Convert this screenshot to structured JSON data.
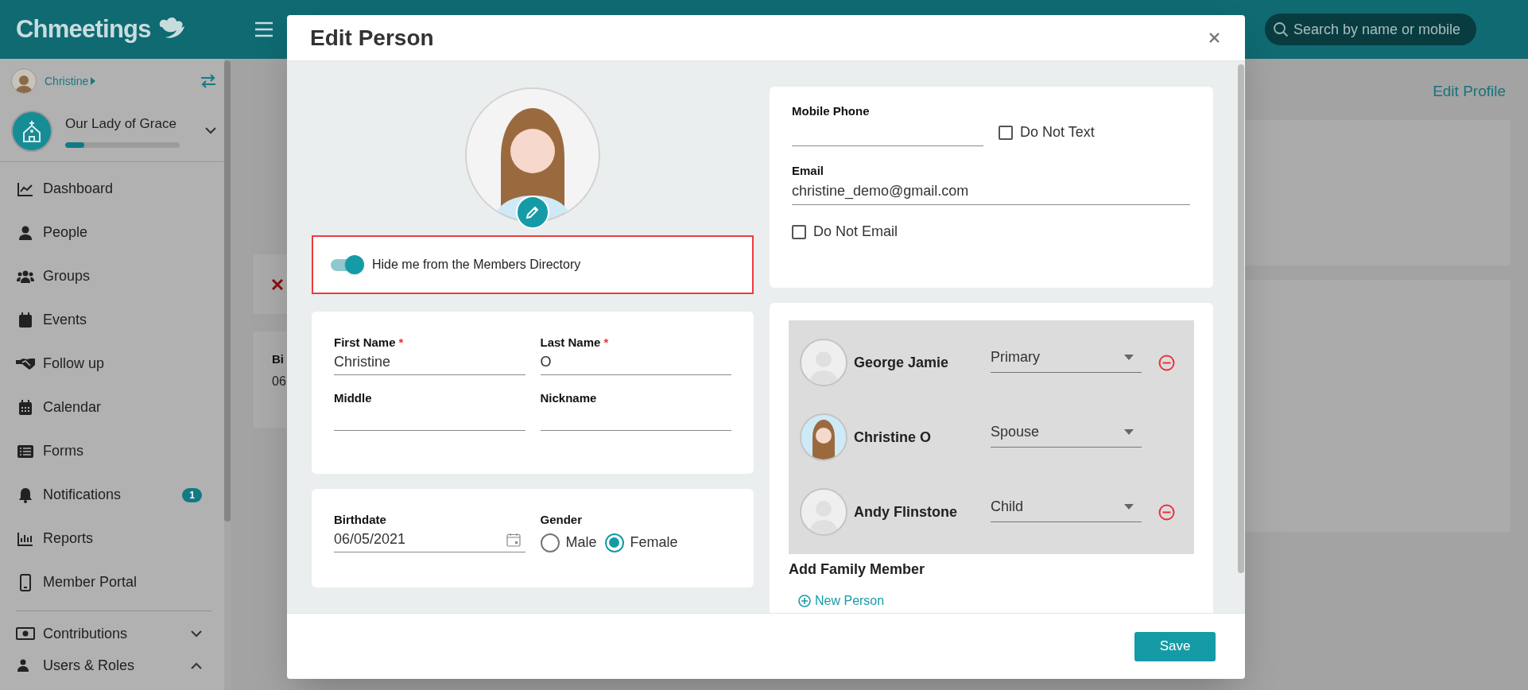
{
  "header": {
    "logo": "Chmeetings",
    "search": {
      "placeholder": "Search by name or mobile"
    }
  },
  "sidebar": {
    "user": "Christine",
    "church": {
      "name": "Our Lady of Grace",
      "level": 0.17
    },
    "items": [
      {
        "label": "Dashboard",
        "kind": "link"
      },
      {
        "label": "People",
        "kind": "link"
      },
      {
        "label": "Groups",
        "kind": "link"
      },
      {
        "label": "Events",
        "kind": "link"
      },
      {
        "label": "Follow up",
        "kind": "link"
      },
      {
        "label": "Calendar",
        "kind": "link"
      },
      {
        "label": "Forms",
        "kind": "link"
      },
      {
        "label": "Notifications",
        "kind": "link",
        "badge": "1"
      },
      {
        "label": "Reports",
        "kind": "link"
      },
      {
        "label": "Member Portal",
        "kind": "link"
      },
      {
        "label": "Contributions",
        "kind": "group",
        "expanded": false
      },
      {
        "label": "Users & Roles",
        "kind": "group",
        "expanded": true
      }
    ]
  },
  "page": {
    "edit_profile": "Edit Profile",
    "card": {
      "label": "Bi",
      "value": "06"
    }
  },
  "modal": {
    "title": "Edit Person",
    "hide_from_directory": {
      "label": "Hide me from the Members Directory",
      "on": true,
      "highlighted": true
    },
    "name_fields": [
      {
        "label": "First Name",
        "required_mark": "*",
        "value": "Christine"
      },
      {
        "label": "Last Name",
        "required_mark": "*",
        "value": "O"
      },
      {
        "label": "Middle"
      },
      {
        "label": "Nickname"
      }
    ],
    "birthdate": {
      "label": "Birthdate",
      "value": "06/05/2021"
    },
    "gender": {
      "label": "Gender",
      "options": [
        {
          "label": "Male",
          "selected": false
        },
        {
          "label": "Female",
          "selected": true
        }
      ]
    },
    "mobile_phone": {
      "label": "Mobile Phone",
      "do_not_text": {
        "label": "Do Not Text",
        "checked": false
      }
    },
    "email": {
      "label": "Email",
      "value": "christine_demo@gmail.com",
      "do_not_email": {
        "label": "Do Not Email",
        "checked": false
      }
    },
    "family": [
      {
        "name": "George Jamie",
        "role": "Primary",
        "has_photo": false,
        "removable": true
      },
      {
        "name": "Christine O",
        "role": "Spouse",
        "has_photo": true,
        "removable": false
      },
      {
        "name": "Andy Flinstone",
        "role": "Child",
        "has_photo": false,
        "removable": true
      }
    ],
    "add_family": {
      "title": "Add Family Member",
      "new_person": "New Person"
    },
    "save": "Save"
  }
}
